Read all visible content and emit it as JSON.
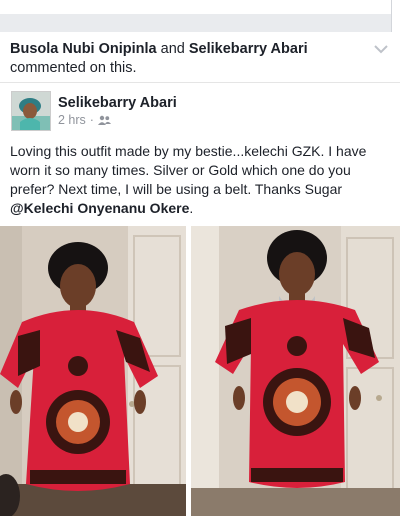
{
  "activity": {
    "user1": "Busola Nubi Onipinla",
    "joiner": " and ",
    "user2": "Selikebarry Abari",
    "suffix": " commented on this."
  },
  "post": {
    "author": "Selikebarry Abari",
    "time": "2 hrs",
    "privacy_icon": "friends-icon",
    "text_before": "Loving this outfit made by my bestie...kelechi GZK. I have worn it so many times. Silver or Gold which one do you prefer? Next time, I will be using a belt. Thanks Sugar ",
    "mention": "@Kelechi Onyenanu Okere",
    "text_after": "."
  },
  "colors": {
    "dress_red": "#d8203a",
    "meta_gray": "#90949c",
    "divider": "#e9ebee"
  }
}
